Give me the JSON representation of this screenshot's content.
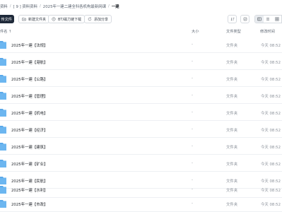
{
  "breadcrumb": {
    "items": [
      "资料",
      "[ 9 ] 资料资料",
      "2025年一建二建全科各机构最新网课",
      "一建"
    ]
  },
  "toolbar": {
    "new_label": "传文件",
    "new_folder_label": "新建文件夹",
    "offline_download_label": "BT/磁力链下载",
    "add_share_label": "添加分享"
  },
  "columns": {
    "name": "件名",
    "size": "大小",
    "type": "文件类型",
    "time": "修改时间"
  },
  "files": [
    {
      "name": "2025年一建【法规】",
      "size": "-",
      "type": "文件夹",
      "time": "今天 08:52"
    },
    {
      "name": "2025年一建【港航】",
      "size": "-",
      "type": "文件夹",
      "time": "今天 08:52"
    },
    {
      "name": "2025年一建【公路】",
      "size": "-",
      "type": "文件夹",
      "time": "今天 08:52"
    },
    {
      "name": "2025年一建【管理】",
      "size": "-",
      "type": "文件夹",
      "time": "今天 08:52"
    },
    {
      "name": "2025年一建【机电】",
      "size": "-",
      "type": "文件夹",
      "time": "今天 08:52"
    },
    {
      "name": "2025年一建【经济】",
      "size": "-",
      "type": "文件夹",
      "time": "今天 08:52"
    },
    {
      "name": "2025年一建【建筑】",
      "size": "-",
      "type": "文件夹",
      "time": "今天 08:52"
    },
    {
      "name": "2025年一建【矿业】",
      "size": "-",
      "type": "文件夹",
      "time": "今天 08:52"
    },
    {
      "name": "2025年一建【民航】",
      "size": "-",
      "type": "文件夹",
      "time": "今天 08:52"
    },
    {
      "name": "2025年一建【水利】",
      "size": "-",
      "type": "文件夹",
      "time": "今天 08:52"
    },
    {
      "name": "2025年一建【市政】",
      "size": "-",
      "type": "文件夹",
      "time": "今天 08:52"
    }
  ],
  "colors": {
    "folder": "#5aa9ea",
    "primary_button": "#1f2a3a"
  }
}
